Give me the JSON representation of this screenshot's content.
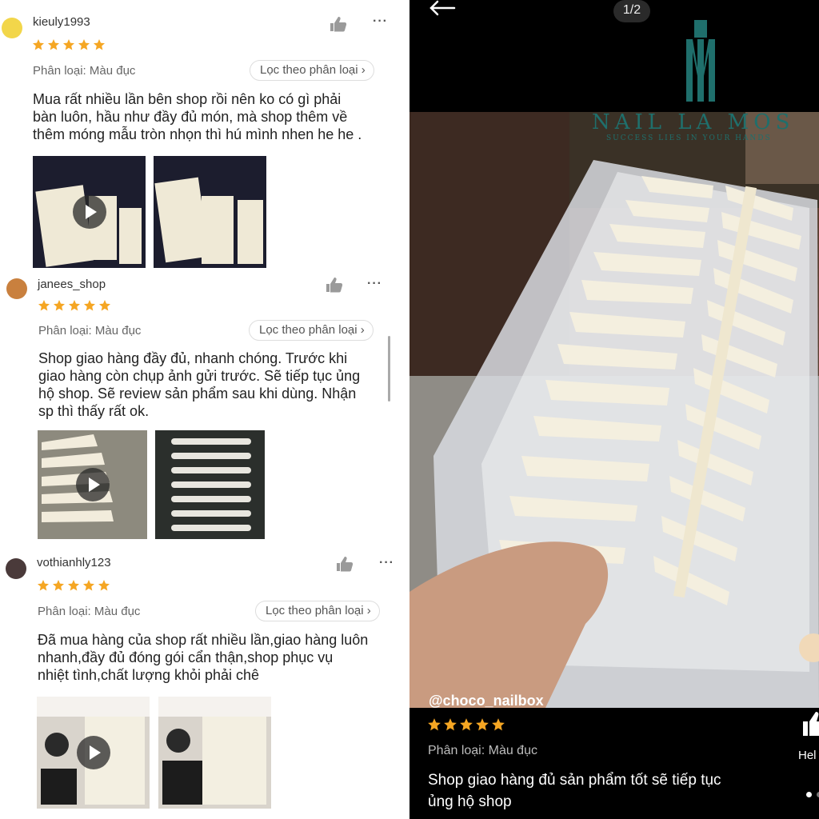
{
  "reviews": [
    {
      "username": "kieuly1993",
      "rating": 5,
      "variant": "Phân loại: Màu đục",
      "filter_label": "Lọc theo phân loại",
      "text_lines": [
        "Mua rất nhiều lần bên shop rồi nên ko có gì phải",
        "bàn luôn, hầu như đầy đủ món, mà shop thêm về",
        "thêm móng mẫu tròn nhọn thì hú mình nhen he he ."
      ]
    },
    {
      "username": "janees_shop",
      "rating": 5,
      "variant": "Phân loại: Màu đục",
      "filter_label": "Lọc theo phân loại",
      "text_lines": [
        "Shop giao hàng đầy đủ, nhanh chóng. Trước khi",
        "giao hàng còn chụp ảnh gửi trước. Sẽ tiếp tục ủng",
        "hộ shop. Sẽ review sản phẩm sau khi dùng. Nhận",
        "sp thì thấy rất ok."
      ]
    },
    {
      "username": "vothianhly123",
      "rating": 5,
      "variant": "Phân loại: Màu đục",
      "filter_label": "Lọc theo phân loại",
      "text_lines": [
        "Đã mua hàng của shop rất nhiều lần,giao hàng luôn",
        "nhanh,đầy đủ đóng gói cẩn thận,shop phục vụ",
        "nhiệt tình,chất lượng khỏi phải chê"
      ]
    }
  ],
  "viewer": {
    "counter": "1/2",
    "brand": "NAIL LA MOS",
    "slogan": "SUCCESS LIES IN YOUR HANDS",
    "username": "@choco_nailbox",
    "rating": 5,
    "variant": "Phân loại: Màu đục",
    "text": "Shop giao hàng đủ sản phẩm tốt sẽ tiếp tục ủng hộ shop",
    "helpful_label": "Hel"
  },
  "colors": {
    "star": "#f5a623",
    "brand_teal": "#1f6f6c"
  }
}
